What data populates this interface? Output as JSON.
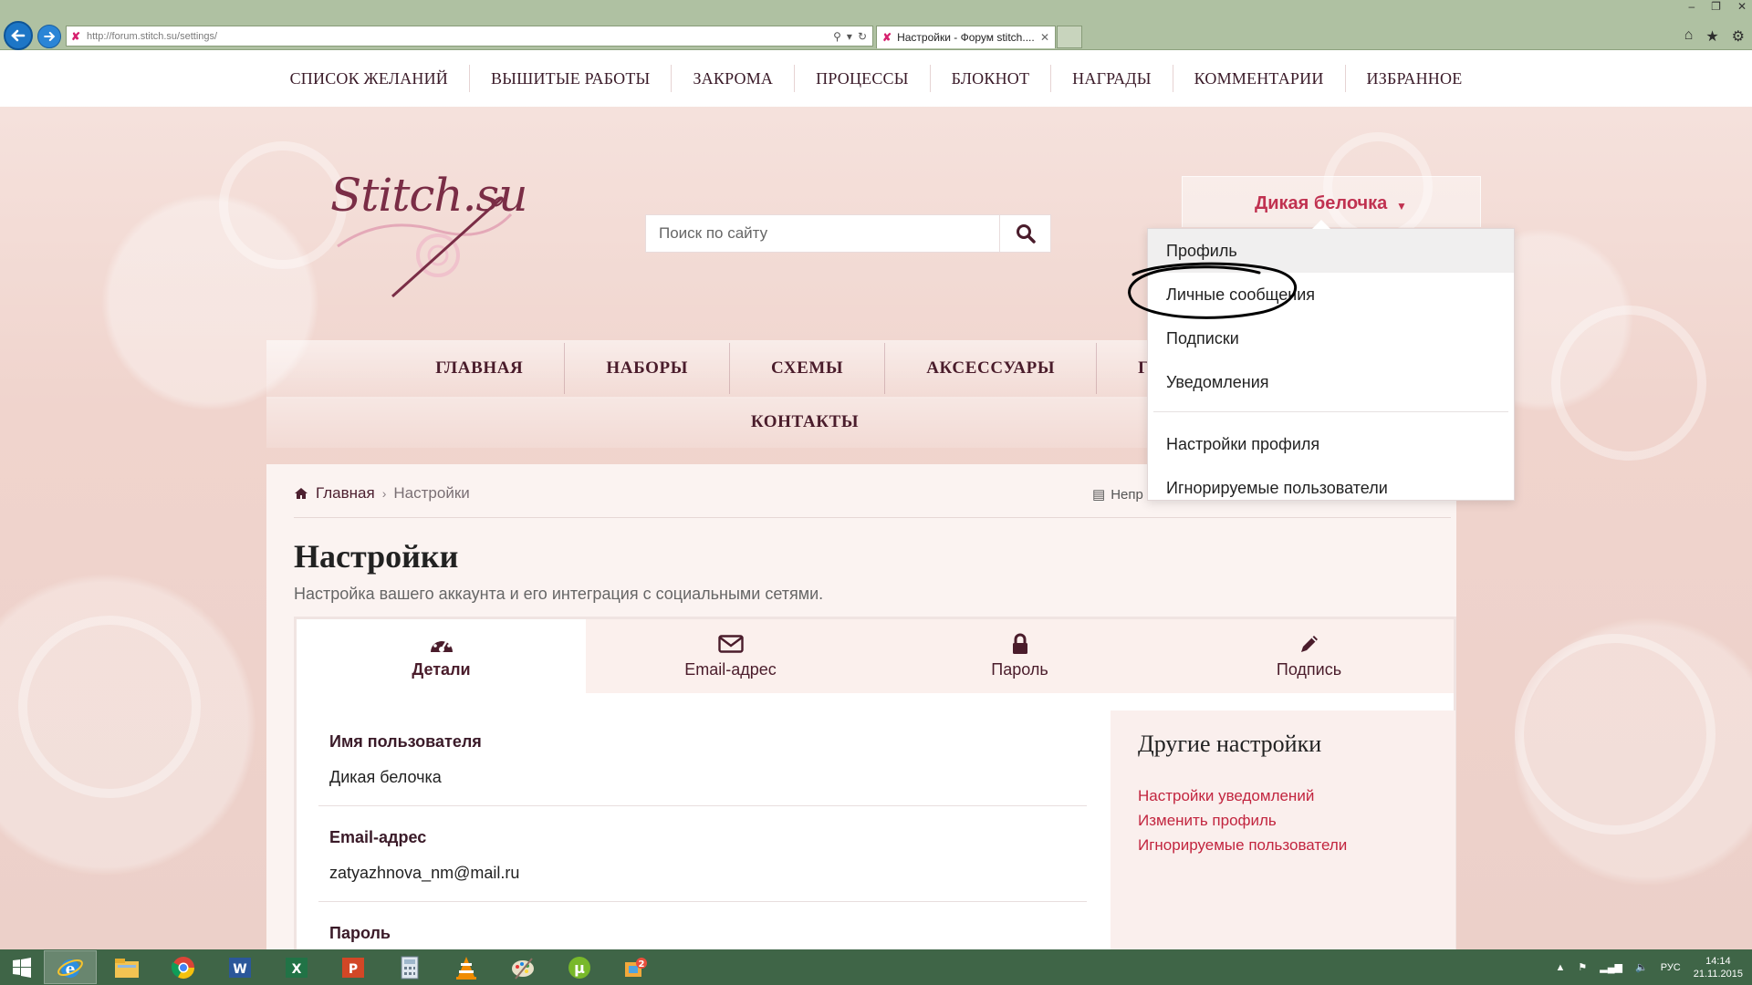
{
  "browser": {
    "url": "http://forum.stitch.su/settings/",
    "tab_title": "Настройки - Форум stitch....",
    "favicon": "stitch-favicon"
  },
  "top_nav": [
    "СПИСОК ЖЕЛАНИЙ",
    "ВЫШИТЫЕ РАБОТЫ",
    "ЗАКРОМА",
    "ПРОЦЕССЫ",
    "БЛОКНОТ",
    "НАГРАДЫ",
    "КОММЕНТАРИИ",
    "ИЗБРАННОЕ"
  ],
  "logo": {
    "text": "Stitch.su"
  },
  "search": {
    "placeholder": "Поиск по сайту"
  },
  "user": {
    "name": "Дикая белочка"
  },
  "user_menu": {
    "items": [
      "Профиль",
      "Личные сообщения",
      "Подписки",
      "Уведомления"
    ],
    "items2": [
      "Настройки профиля",
      "Игнорируемые пользователи"
    ],
    "highlighted": "Профиль"
  },
  "main_nav": {
    "row1": [
      "ГЛАВНАЯ",
      "НАБОРЫ",
      "СХЕМЫ",
      "АКСЕССУАРЫ",
      "ГАЛ"
    ],
    "row2": [
      "КОНТАКТЫ"
    ]
  },
  "breadcrumb": {
    "home": "Главная",
    "current": "Настройки"
  },
  "unread_label": "Непр",
  "page": {
    "title": "Настройки",
    "subtitle": "Настройка вашего аккаунта и его интеграция с социальными сетями."
  },
  "tabs": [
    {
      "label": "Детали",
      "icon": "dashboard-icon",
      "active": true
    },
    {
      "label": "Email-адрес",
      "icon": "envelope-icon",
      "active": false
    },
    {
      "label": "Пароль",
      "icon": "lock-icon",
      "active": false
    },
    {
      "label": "Подпись",
      "icon": "pencil-icon",
      "active": false
    }
  ],
  "details": [
    {
      "label": "Имя пользователя",
      "value": "Дикая белочка"
    },
    {
      "label": "Email-адрес",
      "value": "zatyazhnova_nm@mail.ru"
    },
    {
      "label": "Пароль",
      "value": ""
    }
  ],
  "other_settings": {
    "title": "Другие настройки",
    "links": [
      "Настройки уведомлений",
      "Изменить профиль",
      "Игнорируемые пользователи"
    ]
  },
  "taskbar": {
    "apps": [
      "internet-explorer",
      "file-explorer",
      "chrome",
      "word",
      "excel",
      "powerpoint",
      "calculator",
      "vlc",
      "paint",
      "utorrent",
      "game"
    ],
    "lang": "РУС",
    "time": "14:14",
    "date": "21.11.2015"
  },
  "colors": {
    "accent": "#c2253f",
    "brand": "#4a1c2b",
    "chrome": "#afc1a2",
    "taskbar": "#3f6547"
  }
}
